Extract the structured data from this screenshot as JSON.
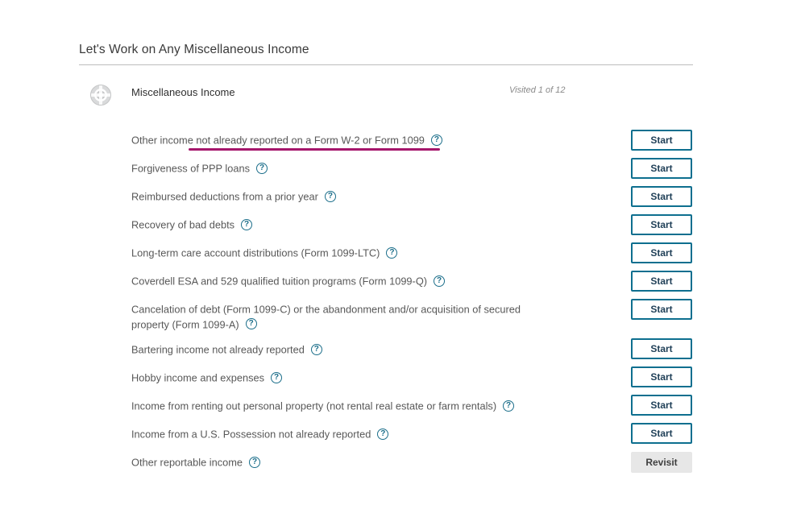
{
  "page": {
    "title": "Let's Work on Any Miscellaneous Income"
  },
  "section": {
    "title": "Miscellaneous Income",
    "visited": "Visited 1 of 12",
    "icon": "lifebuoy-icon"
  },
  "accent": {
    "button_border": "#0e6f8f",
    "help_icon": "#1b6e8a",
    "annotation": "#a5166b"
  },
  "rows": [
    {
      "label": "Other income not already reported on a Form W-2 or Form 1099",
      "action": "Start"
    },
    {
      "label": "Forgiveness of PPP loans",
      "action": "Start"
    },
    {
      "label": "Reimbursed deductions from a prior year",
      "action": "Start"
    },
    {
      "label": "Recovery of bad debts",
      "action": "Start"
    },
    {
      "label": "Long-term care account distributions (Form 1099-LTC)",
      "action": "Start"
    },
    {
      "label": "Coverdell ESA and 529 qualified tuition programs (Form 1099-Q)",
      "action": "Start"
    },
    {
      "label": "Cancelation of debt (Form 1099-C) or the abandonment and/or acquisition of secured property (Form 1099-A)",
      "action": "Start"
    },
    {
      "label": "Bartering income not already reported",
      "action": "Start"
    },
    {
      "label": "Hobby income and expenses",
      "action": "Start"
    },
    {
      "label": "Income from renting out personal property (not rental real estate or farm rentals)",
      "action": "Start"
    },
    {
      "label": "Income from a U.S. Possession not already reported",
      "action": "Start"
    },
    {
      "label": "Other reportable income",
      "action": "Revisit"
    }
  ],
  "help_glyph": "?"
}
